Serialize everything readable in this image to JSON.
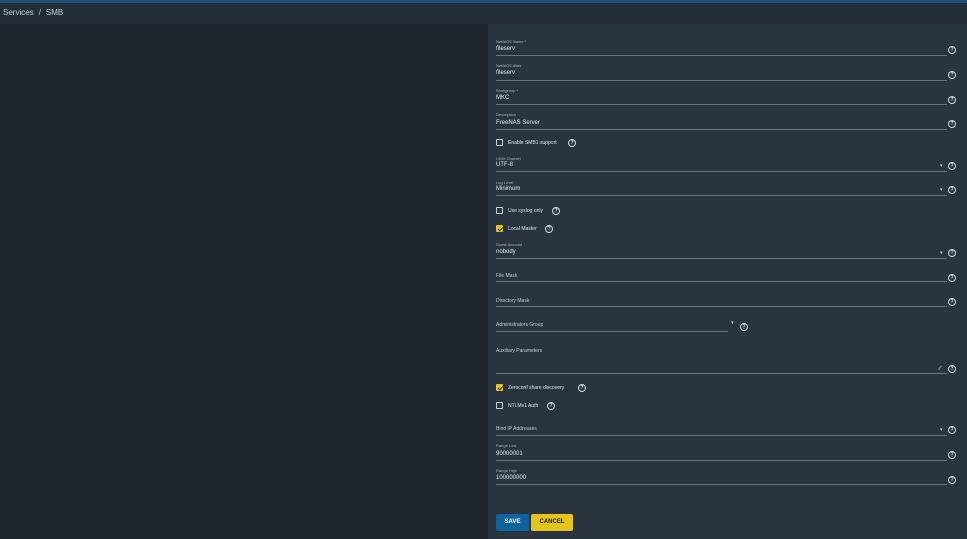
{
  "breadcrumb": {
    "parent": "Services",
    "separator": "/",
    "current": "SMB"
  },
  "form": {
    "netbios_name": {
      "label": "NetBIOS Name *",
      "value": "fileserv"
    },
    "netbios_alias": {
      "label": "NetBIOS Alias",
      "value": "fileserv"
    },
    "workgroup": {
      "label": "Workgroup *",
      "value": "MKC"
    },
    "description": {
      "label": "Description",
      "value": "FreeNAS Server"
    },
    "enable_smb1": {
      "label": "Enable SMB1 support",
      "checked": false
    },
    "unix_charset": {
      "label": "UNIX Charset",
      "value": "UTF-8"
    },
    "log_level": {
      "label": "Log Level",
      "value": "Minimum"
    },
    "use_syslog": {
      "label": "Use syslog only",
      "checked": false
    },
    "local_master": {
      "label": "Local Master",
      "checked": true
    },
    "guest_account": {
      "label": "Guest Account",
      "value": "nobody"
    },
    "file_mask": {
      "placeholder": "File Mask"
    },
    "directory_mask": {
      "placeholder": "Directory Mask"
    },
    "administrators_group": {
      "placeholder": "Administrators Group"
    },
    "auxiliary_parameters": {
      "placeholder": "Auxiliary Parameters"
    },
    "zeroconf": {
      "label": "Zeroconf share discovery",
      "checked": true
    },
    "ntlmv1": {
      "label": "NTLMv1 Auth",
      "checked": false
    },
    "bind_ip": {
      "placeholder": "Bind IP Addresses"
    },
    "range_low": {
      "label": "Range Low",
      "value": "90000001"
    },
    "range_high": {
      "label": "Range High",
      "value": "100000000"
    }
  },
  "buttons": {
    "save": "SAVE",
    "cancel": "CANCEL"
  },
  "icons": {
    "help": "help-circle-icon",
    "dropdown": "caret-down-icon"
  },
  "colors": {
    "accent": "#e5c41e",
    "primary": "#0d63a0",
    "panel": "#29343e",
    "background": "#1c232b"
  }
}
